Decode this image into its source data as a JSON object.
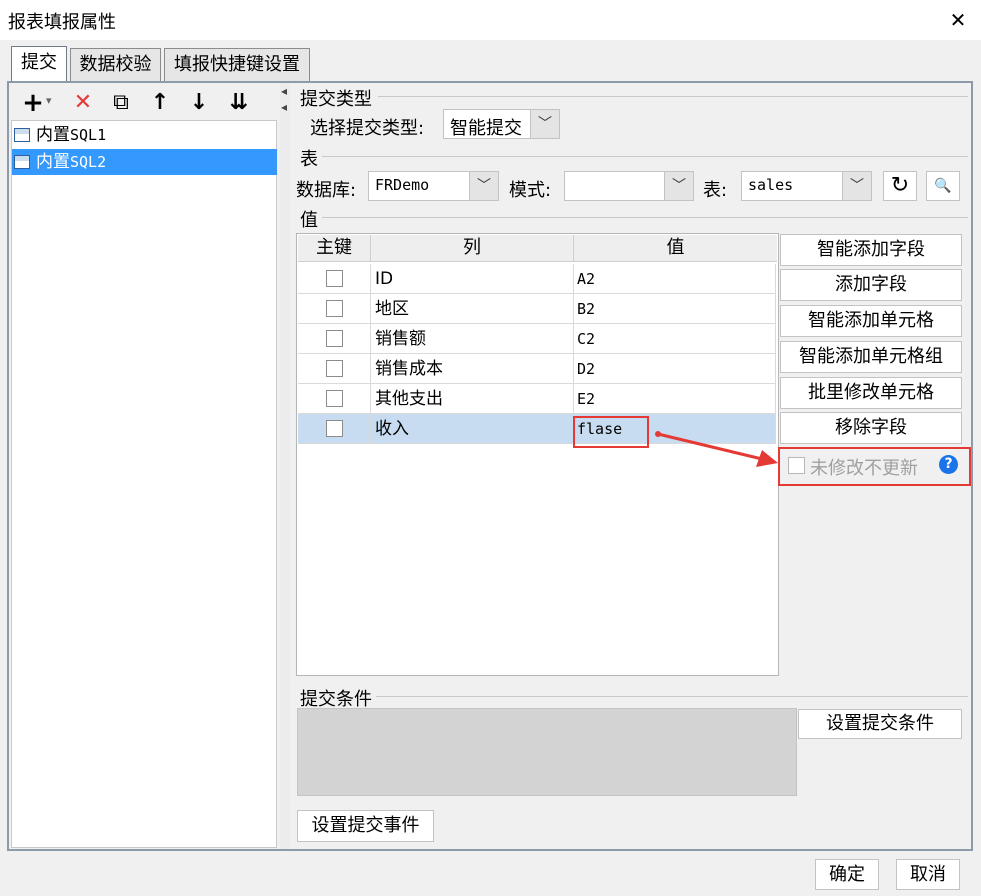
{
  "window": {
    "title": "报表填报属性",
    "close_glyph": "✕"
  },
  "tabs": [
    {
      "label": "提交"
    },
    {
      "label": "数据校验"
    },
    {
      "label": "填报快捷键设置"
    }
  ],
  "toolbar": {
    "add_glyph": "+",
    "add_caret": "▾",
    "delete_glyph": "✕",
    "copy_glyph": "⧉",
    "up_glyph": "↑",
    "down_glyph": "↓",
    "sort_glyph": "⇊"
  },
  "sql_list": {
    "items": [
      {
        "label": "内置",
        "suffix": "SQL1"
      },
      {
        "label": "内置",
        "suffix": "SQL2"
      }
    ]
  },
  "splitter": {
    "up": "◂",
    "down": "◂"
  },
  "submit_type": {
    "section_title": "提交类型",
    "label": "选择提交类型:",
    "value": "智能提交"
  },
  "table_section": {
    "section_title": "表",
    "db_label": "数据库:",
    "db_value": "FRDemo",
    "mode_label": "模式:",
    "mode_value": "",
    "table_label": "表:",
    "table_value": "sales",
    "refresh_glyph": "↻",
    "search_glyph": "🔍"
  },
  "value_section": {
    "section_title": "值",
    "headers": {
      "key": "主键",
      "column": "列",
      "value": "值"
    },
    "rows": [
      {
        "column": "ID",
        "value": "A2"
      },
      {
        "column": "地区",
        "value": "B2"
      },
      {
        "column": "销售额",
        "value": "C2"
      },
      {
        "column": "销售成本",
        "value": "D2"
      },
      {
        "column": "其他支出",
        "value": "E2"
      },
      {
        "column": "收入",
        "value": "flase"
      }
    ]
  },
  "side_buttons": {
    "smart_add_field": "智能添加字段",
    "add_field": "添加字段",
    "smart_add_cell": "智能添加单元格",
    "smart_add_cell_group": "智能添加单元格组",
    "batch_modify_cell": "批里修改单元格",
    "remove_field": "移除字段",
    "no_update_label": "未修改不更新",
    "help_glyph": "?"
  },
  "condition_section": {
    "section_title": "提交条件",
    "set_condition": "设置提交条件"
  },
  "set_event": "设置提交事件",
  "footer": {
    "ok": "确定",
    "cancel": "取消"
  },
  "colors": {
    "accent": "#3399ff",
    "highlight": "#e53935",
    "help": "#1a73e8"
  }
}
